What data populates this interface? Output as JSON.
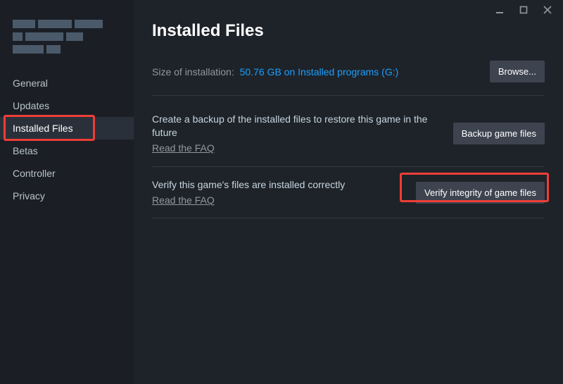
{
  "sidebar": {
    "items": [
      {
        "label": "General"
      },
      {
        "label": "Updates"
      },
      {
        "label": "Installed Files"
      },
      {
        "label": "Betas"
      },
      {
        "label": "Controller"
      },
      {
        "label": "Privacy"
      }
    ],
    "active_index": 2
  },
  "main": {
    "title": "Installed Files",
    "size_label": "Size of installation:",
    "size_value": "50.76 GB on Installed programs (G:)",
    "browse_label": "Browse...",
    "backup": {
      "text": "Create a backup of the installed files to restore this game in the future",
      "faq": "Read the FAQ",
      "button": "Backup game files"
    },
    "verify": {
      "text": "Verify this game's files are installed correctly",
      "faq": "Read the FAQ",
      "button": "Verify integrity of game files"
    }
  }
}
